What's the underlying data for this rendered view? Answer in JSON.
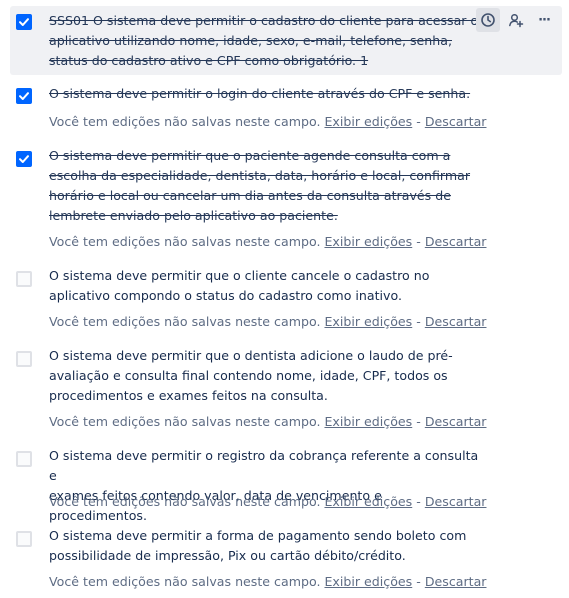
{
  "colors": {
    "checkbox_checked": "#0065ff",
    "checkbox_unchecked_border": "#dfe1e6",
    "hover_background": "#f0f1f4",
    "muted_text": "#5e6c84"
  },
  "actions": {
    "due_date_icon": "clock-icon",
    "assign_icon": "add-user-icon",
    "more_icon": "more-horizontal-icon",
    "more_label": "···"
  },
  "unsaved": {
    "message": "Você tem edições não salvas neste campo.",
    "view_label": "Exibir edições",
    "separator": "-",
    "discard_label": "Descartar"
  },
  "items": [
    {
      "checked": true,
      "text": "SSS01 O sistema deve permitir o cadastro do cliente para acessar o\naplicativo utilizando nome, idade, sexo, e-mail, telefone, senha,\nstatus do cadastro ativo e CPF como obrigatório. 1"
    },
    {
      "checked": true,
      "text": "O sistema deve permitir o login do cliente através do CPF e senha."
    },
    {
      "checked": true,
      "text": "O sistema deve permitir que o paciente agende consulta com a\nescolha da especialidade, dentista, data, horário e local, confirmar\nhorário e local ou cancelar um dia antes da consulta através de\nlembrete enviado pelo aplicativo ao paciente."
    },
    {
      "checked": false,
      "text": "O sistema deve permitir que o cliente cancele o cadastro no\naplicativo compondo o status do cadastro como inativo."
    },
    {
      "checked": false,
      "text": "O sistema deve permitir que o dentista adicione o laudo de pré-\navaliação e consulta final contendo nome, idade, CPF, todos os\nprocedimentos e exames feitos na consulta."
    },
    {
      "checked": false,
      "text": "O sistema deve permitir o registro da cobrança referente a consulta e\nexames feitos contendo valor, data de vencimento e procedimentos."
    },
    {
      "checked": false,
      "text": "O sistema deve permitir a forma de pagamento sendo boleto com\npossibilidade de impressão, Pix ou cartão débito/crédito."
    }
  ]
}
